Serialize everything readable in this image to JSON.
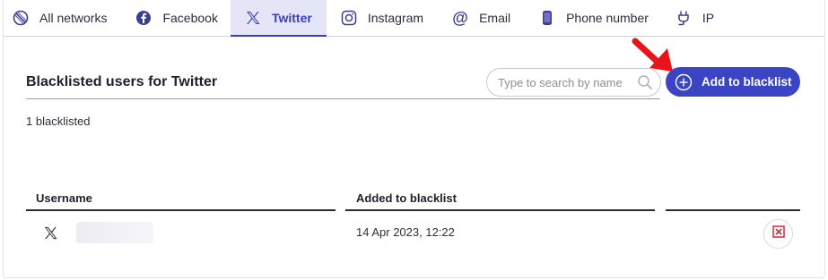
{
  "tabs": [
    {
      "label": "All networks",
      "icon": "no-network-icon"
    },
    {
      "label": "Facebook",
      "icon": "facebook-icon"
    },
    {
      "label": "Twitter",
      "icon": "x-twitter-icon",
      "active": true
    },
    {
      "label": "Instagram",
      "icon": "instagram-icon"
    },
    {
      "label": "Email",
      "icon": "at-sign-icon"
    },
    {
      "label": "Phone number",
      "icon": "phone-icon"
    },
    {
      "label": "IP",
      "icon": "plug-icon"
    }
  ],
  "header": {
    "title": "Blacklisted users for Twitter",
    "search_placeholder": "Type to search by name",
    "add_button_label": "Add to blacklist"
  },
  "summary": {
    "count_text": "1 blacklisted"
  },
  "table": {
    "columns": [
      "Username",
      "Added to blacklist"
    ],
    "rows": [
      {
        "network_icon": "x-twitter-icon",
        "username": "",
        "added": "14 Apr 2023, 12:22"
      }
    ]
  },
  "colors": {
    "accent": "#3b44c4",
    "active_tab_bg": "#e4e5f7",
    "delete_red": "#e0233a",
    "annotation_arrow": "#e8141c"
  }
}
